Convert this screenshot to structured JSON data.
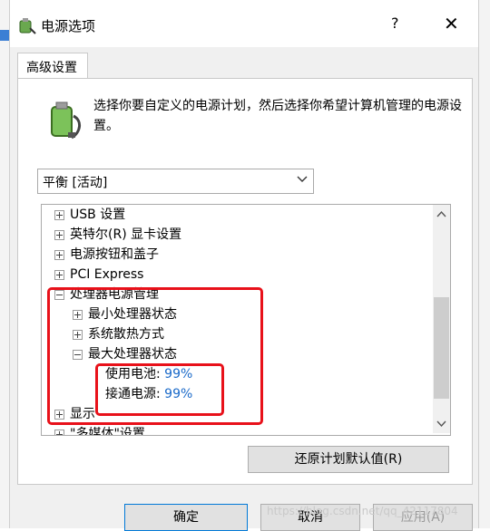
{
  "window": {
    "title": "电源选项",
    "help_label": "?",
    "close_label": "✕"
  },
  "tab": {
    "label": "高级设置"
  },
  "description": "选择你要自定义的电源计划，然后选择你希望计算机管理的电源设置。",
  "plan_select": {
    "value": "平衡 [活动]"
  },
  "tree": {
    "items": [
      {
        "label": "USB 设置"
      },
      {
        "label": "英特尔(R) 显卡设置"
      },
      {
        "label": "电源按钮和盖子"
      },
      {
        "label": "PCI Express"
      },
      {
        "label": "处理器电源管理"
      },
      {
        "label": "最小处理器状态"
      },
      {
        "label": "系统散热方式"
      },
      {
        "label": "最大处理器状态"
      },
      {
        "label": "显示"
      },
      {
        "label": "\"多媒体\"设置"
      }
    ],
    "battery": {
      "label": "使用电池:",
      "value": "99%"
    },
    "plugged": {
      "label": "接通电源:",
      "value": "99%"
    }
  },
  "buttons": {
    "restore": "还原计划默认值(R)",
    "ok": "确定",
    "cancel": "取消",
    "apply": "应用(A)"
  },
  "watermark": "https://blog.csdn.net/qq_42117804",
  "colors": {
    "highlight_box": "#e8111a",
    "value_text": "#1b6ac9"
  }
}
